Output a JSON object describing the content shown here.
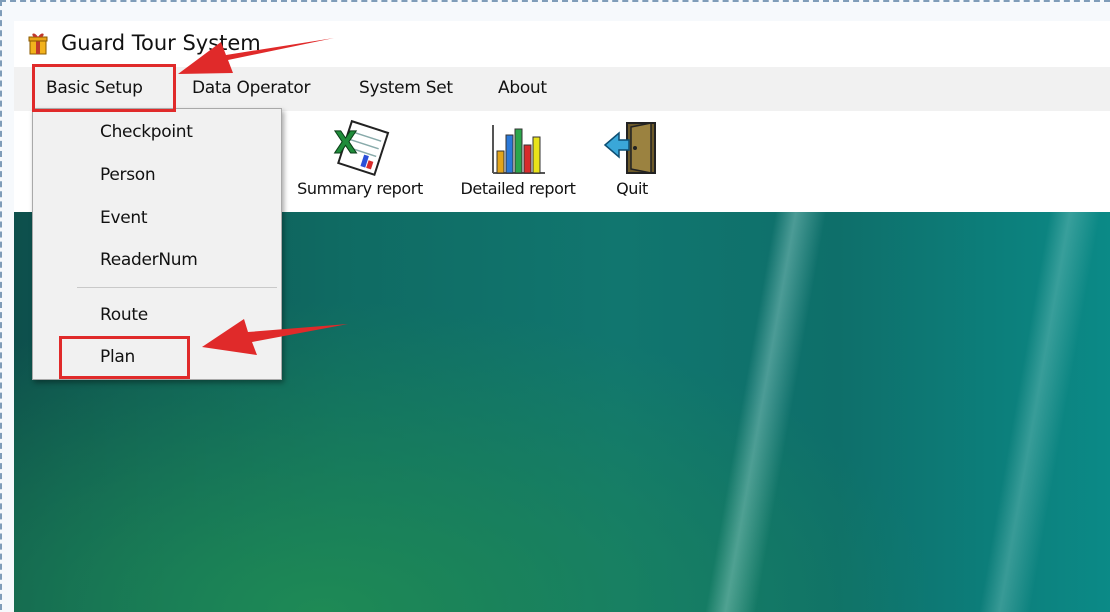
{
  "window": {
    "title": "Guard Tour System",
    "icon": "app-gift-icon"
  },
  "menubar": {
    "items": [
      {
        "label": "Basic Setup"
      },
      {
        "label": "Data Operator"
      },
      {
        "label": "System Set"
      },
      {
        "label": "About"
      }
    ]
  },
  "toolbar": {
    "items": [
      {
        "label": "Summary report",
        "icon": "excel-report-icon"
      },
      {
        "label": "Detailed report",
        "icon": "bar-chart-icon"
      },
      {
        "label": "Quit",
        "icon": "exit-door-icon"
      }
    ]
  },
  "dropdown": {
    "group1": [
      {
        "label": "Checkpoint"
      },
      {
        "label": "Person"
      },
      {
        "label": "Event"
      },
      {
        "label": "ReaderNum"
      }
    ],
    "group2": [
      {
        "label": "Route"
      },
      {
        "label": "Plan"
      }
    ]
  },
  "annotations": {
    "highlight_color": "#e02a2a"
  },
  "colors": {
    "desktop_teal": "#0f6b63",
    "menubar_bg": "#f1f1f1"
  }
}
